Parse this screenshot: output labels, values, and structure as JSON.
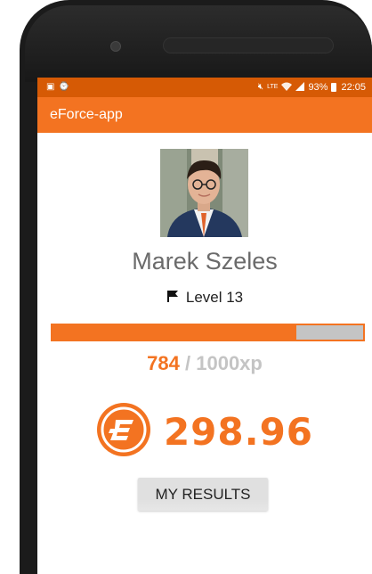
{
  "status_bar": {
    "battery": "93%",
    "time": "22:05",
    "network": "LTE"
  },
  "app_bar": {
    "title": "eForce-app"
  },
  "profile": {
    "name": "Marek Szeles",
    "level_label": "Level 13",
    "xp_current": "784",
    "xp_separator": "/",
    "xp_total": "1000xp",
    "xp_progress": 0.784
  },
  "balance": {
    "value": "298.96"
  },
  "actions": {
    "my_results_label": "MY RESULTS"
  },
  "colors": {
    "status_bar": "#d65a05",
    "accent": "#f37321",
    "progress_track": "#c4c4c4",
    "name_text": "#6b6b6b"
  },
  "icons": {
    "status_left": [
      "image-icon",
      "alarm-icon"
    ],
    "status_right": [
      "mute-icon",
      "lte-icon",
      "wifi-icon",
      "signal-icon",
      "battery-icon"
    ],
    "level": "flag-icon",
    "balance": "eforce-coin-icon"
  }
}
